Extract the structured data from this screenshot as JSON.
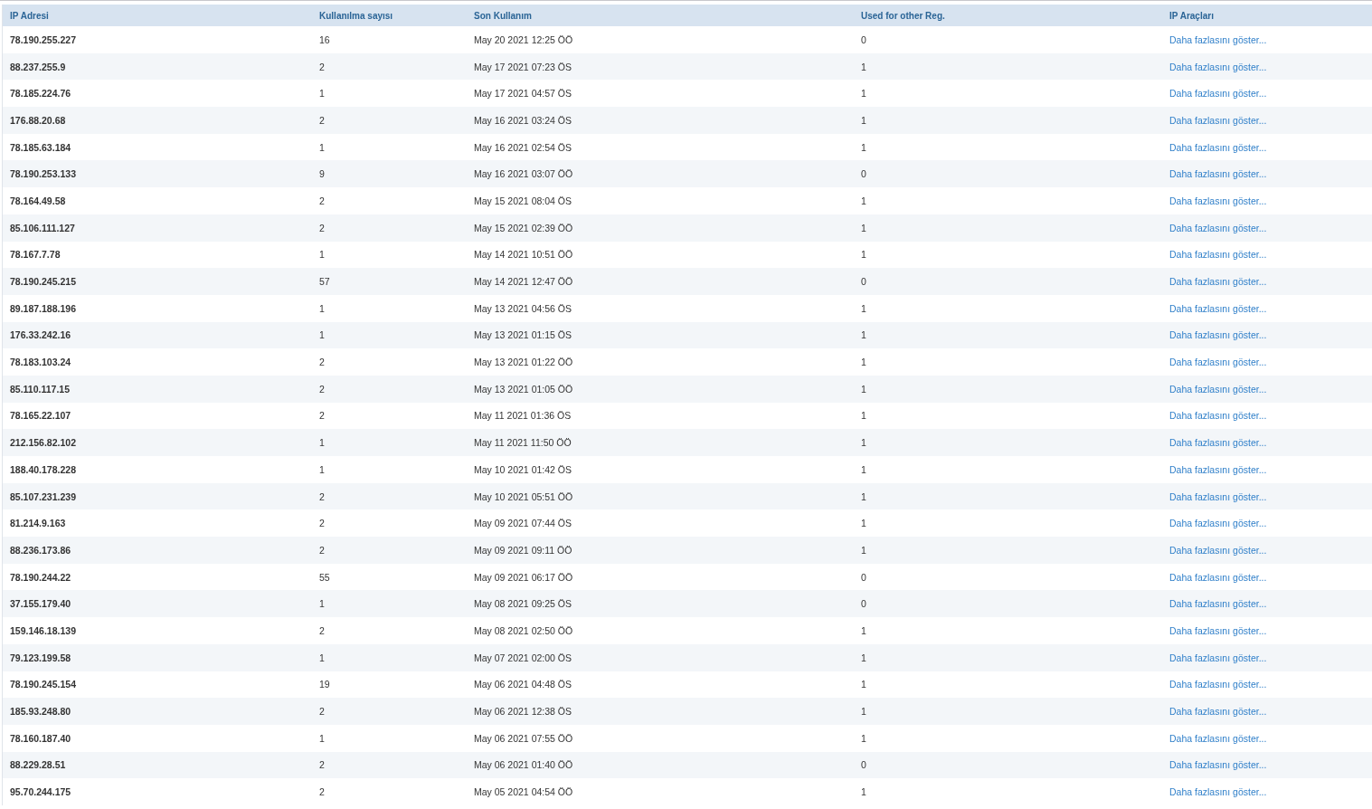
{
  "table": {
    "columns": [
      "IP Adresi",
      "Kullanılma sayısı",
      "Son Kullanım",
      "Used for other Reg.",
      "IP Araçları"
    ],
    "rows": [
      {
        "ip": "78.190.255.227",
        "count": "16",
        "last_used": "May 20 2021 12:25 ÖÖ",
        "other_reg": "0",
        "tools": "Daha fazlasını göster..."
      },
      {
        "ip": "88.237.255.9",
        "count": "2",
        "last_used": "May 17 2021 07:23 ÖS",
        "other_reg": "1",
        "tools": "Daha fazlasını göster..."
      },
      {
        "ip": "78.185.224.76",
        "count": "1",
        "last_used": "May 17 2021 04:57 ÖS",
        "other_reg": "1",
        "tools": "Daha fazlasını göster..."
      },
      {
        "ip": "176.88.20.68",
        "count": "2",
        "last_used": "May 16 2021 03:24 ÖS",
        "other_reg": "1",
        "tools": "Daha fazlasını göster..."
      },
      {
        "ip": "78.185.63.184",
        "count": "1",
        "last_used": "May 16 2021 02:54 ÖS",
        "other_reg": "1",
        "tools": "Daha fazlasını göster..."
      },
      {
        "ip": "78.190.253.133",
        "count": "9",
        "last_used": "May 16 2021 03:07 ÖÖ",
        "other_reg": "0",
        "tools": "Daha fazlasını göster..."
      },
      {
        "ip": "78.164.49.58",
        "count": "2",
        "last_used": "May 15 2021 08:04 ÖS",
        "other_reg": "1",
        "tools": "Daha fazlasını göster..."
      },
      {
        "ip": "85.106.111.127",
        "count": "2",
        "last_used": "May 15 2021 02:39 ÖÖ",
        "other_reg": "1",
        "tools": "Daha fazlasını göster..."
      },
      {
        "ip": "78.167.7.78",
        "count": "1",
        "last_used": "May 14 2021 10:51 ÖÖ",
        "other_reg": "1",
        "tools": "Daha fazlasını göster..."
      },
      {
        "ip": "78.190.245.215",
        "count": "57",
        "last_used": "May 14 2021 12:47 ÖÖ",
        "other_reg": "0",
        "tools": "Daha fazlasını göster..."
      },
      {
        "ip": "89.187.188.196",
        "count": "1",
        "last_used": "May 13 2021 04:56 ÖS",
        "other_reg": "1",
        "tools": "Daha fazlasını göster..."
      },
      {
        "ip": "176.33.242.16",
        "count": "1",
        "last_used": "May 13 2021 01:15 ÖS",
        "other_reg": "1",
        "tools": "Daha fazlasını göster..."
      },
      {
        "ip": "78.183.103.24",
        "count": "2",
        "last_used": "May 13 2021 01:22 ÖÖ",
        "other_reg": "1",
        "tools": "Daha fazlasını göster..."
      },
      {
        "ip": "85.110.117.15",
        "count": "2",
        "last_used": "May 13 2021 01:05 ÖÖ",
        "other_reg": "1",
        "tools": "Daha fazlasını göster..."
      },
      {
        "ip": "78.165.22.107",
        "count": "2",
        "last_used": "May 11 2021 01:36 ÖS",
        "other_reg": "1",
        "tools": "Daha fazlasını göster..."
      },
      {
        "ip": "212.156.82.102",
        "count": "1",
        "last_used": "May 11 2021 11:50 ÖÖ",
        "other_reg": "1",
        "tools": "Daha fazlasını göster..."
      },
      {
        "ip": "188.40.178.228",
        "count": "1",
        "last_used": "May 10 2021 01:42 ÖS",
        "other_reg": "1",
        "tools": "Daha fazlasını göster..."
      },
      {
        "ip": "85.107.231.239",
        "count": "2",
        "last_used": "May 10 2021 05:51 ÖÖ",
        "other_reg": "1",
        "tools": "Daha fazlasını göster..."
      },
      {
        "ip": "81.214.9.163",
        "count": "2",
        "last_used": "May 09 2021 07:44 ÖS",
        "other_reg": "1",
        "tools": "Daha fazlasını göster..."
      },
      {
        "ip": "88.236.173.86",
        "count": "2",
        "last_used": "May 09 2021 09:11 ÖÖ",
        "other_reg": "1",
        "tools": "Daha fazlasını göster..."
      },
      {
        "ip": "78.190.244.22",
        "count": "55",
        "last_used": "May 09 2021 06:17 ÖÖ",
        "other_reg": "0",
        "tools": "Daha fazlasını göster..."
      },
      {
        "ip": "37.155.179.40",
        "count": "1",
        "last_used": "May 08 2021 09:25 ÖS",
        "other_reg": "0",
        "tools": "Daha fazlasını göster..."
      },
      {
        "ip": "159.146.18.139",
        "count": "2",
        "last_used": "May 08 2021 02:50 ÖÖ",
        "other_reg": "1",
        "tools": "Daha fazlasını göster..."
      },
      {
        "ip": "79.123.199.58",
        "count": "1",
        "last_used": "May 07 2021 02:00 ÖS",
        "other_reg": "1",
        "tools": "Daha fazlasını göster..."
      },
      {
        "ip": "78.190.245.154",
        "count": "19",
        "last_used": "May 06 2021 04:48 ÖS",
        "other_reg": "1",
        "tools": "Daha fazlasını göster..."
      },
      {
        "ip": "185.93.248.80",
        "count": "2",
        "last_used": "May 06 2021 12:38 ÖS",
        "other_reg": "1",
        "tools": "Daha fazlasını göster..."
      },
      {
        "ip": "78.160.187.40",
        "count": "1",
        "last_used": "May 06 2021 07:55 ÖÖ",
        "other_reg": "1",
        "tools": "Daha fazlasını göster..."
      },
      {
        "ip": "88.229.28.51",
        "count": "2",
        "last_used": "May 06 2021 01:40 ÖÖ",
        "other_reg": "0",
        "tools": "Daha fazlasını göster..."
      },
      {
        "ip": "95.70.244.175",
        "count": "2",
        "last_used": "May 05 2021 04:54 ÖÖ",
        "other_reg": "1",
        "tools": "Daha fazlasını göster..."
      }
    ]
  }
}
